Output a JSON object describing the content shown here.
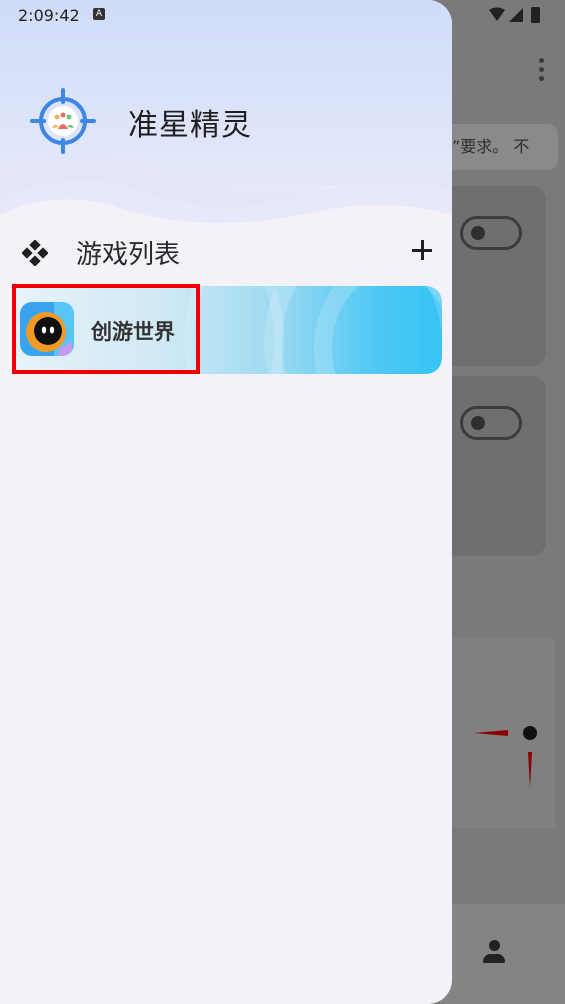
{
  "status_bar": {
    "time": "2:09:42",
    "a_badge": "A"
  },
  "background": {
    "banner_text": "”要求。 不"
  },
  "drawer": {
    "app_title": "准星精灵",
    "section_title": "游戏列表",
    "games": [
      {
        "name": "创游世界"
      }
    ]
  },
  "colors": {
    "highlight": "#ee0000",
    "item_gradient_end": "#36c3f5"
  }
}
